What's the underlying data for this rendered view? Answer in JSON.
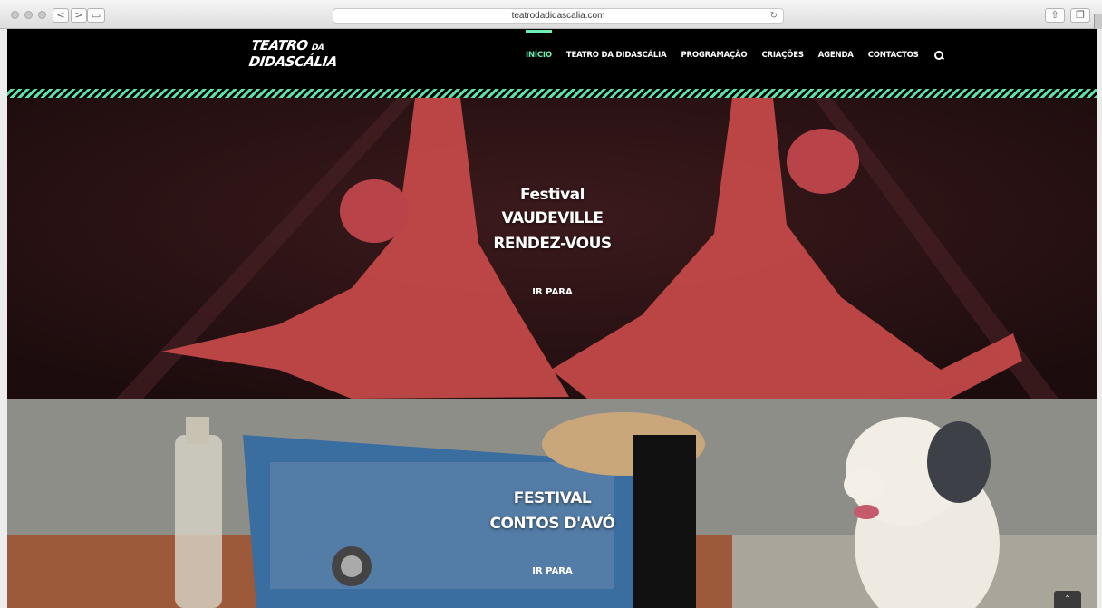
{
  "browser": {
    "url": "teatrodadidascalia.com",
    "back_glyph": "<",
    "forward_glyph": ">",
    "reload_glyph": "↻",
    "share_glyph": "⇧",
    "tabs_glyph": "❐",
    "sidebar_glyph": "▭"
  },
  "site": {
    "logo": {
      "line1": "TEATRO",
      "line1_small": "DA",
      "line2": "DIDASCÁLIA"
    },
    "nav": [
      {
        "label": "INÍCIO",
        "active": true
      },
      {
        "label": "TEATRO DA DIDASCÁLIA"
      },
      {
        "label": "PROGRAMAÇÃO"
      },
      {
        "label": "CRIAÇÕES"
      },
      {
        "label": "AGENDA"
      },
      {
        "label": "CONTACTOS"
      }
    ],
    "accent_color": "#6ef0b4"
  },
  "slides": [
    {
      "title_line1": "Festival",
      "title_line2": "VAUDEVILLE",
      "title_line3": "RENDEZ-VOUS",
      "button": "IR PARA",
      "tint": "#c84a4a"
    },
    {
      "title_line1": "FESTIVAL",
      "title_line2": "CONTOS D'AVÓ",
      "button": "IR PARA"
    }
  ],
  "to_top_glyph": "⌃"
}
